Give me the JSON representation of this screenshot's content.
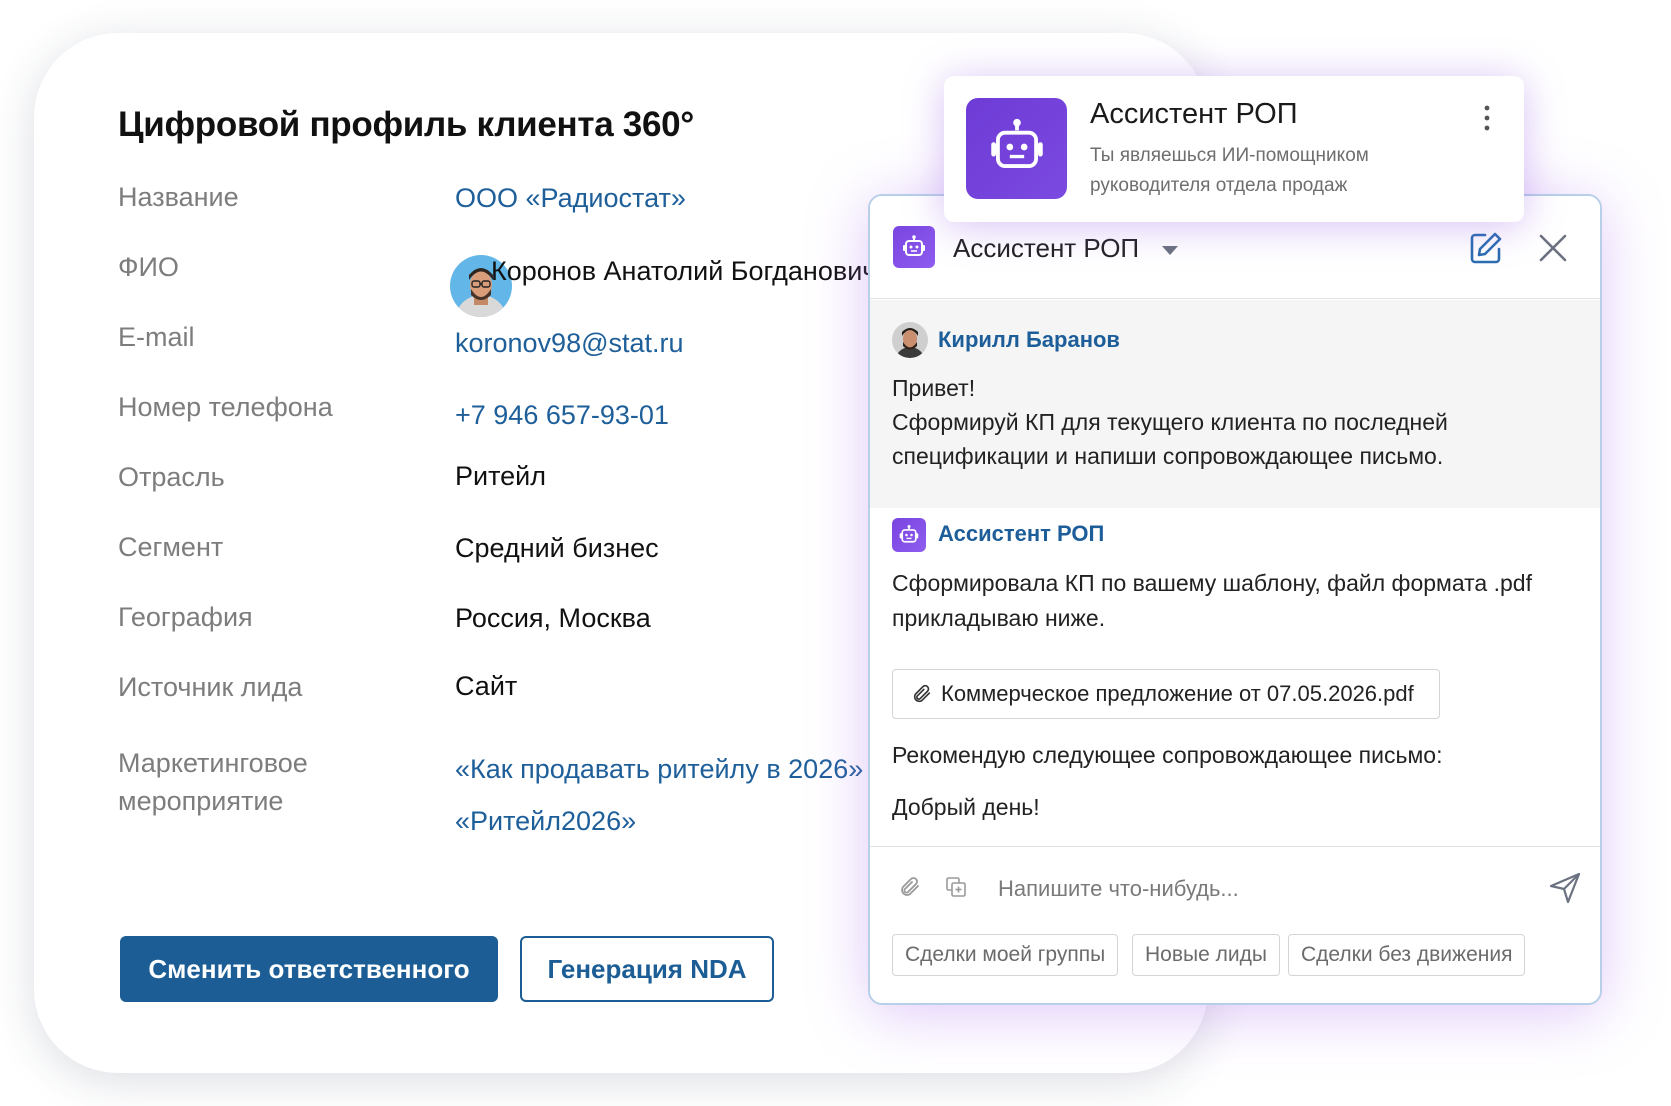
{
  "profile": {
    "title": "Цифровой профиль клиента 360°",
    "fields": {
      "name": {
        "label": "Название",
        "value": "ООО «Радиостат»"
      },
      "fio": {
        "label": "ФИО",
        "value": "Коронов Анатолий Богданович"
      },
      "email": {
        "label": "E-mail",
        "value": "koronov98@stat.ru"
      },
      "phone": {
        "label": "Номер телефона",
        "value": "+7 946 657-93-01"
      },
      "industry": {
        "label": "Отрасль",
        "value": "Ритейл"
      },
      "segment": {
        "label": "Сегмент",
        "value": "Средний бизнес"
      },
      "geo": {
        "label": "География",
        "value": "Россия, Москва"
      },
      "lead_source": {
        "label": "Источник лида",
        "value": "Сайт"
      },
      "marketing": {
        "label_line1": "Маркетинговое",
        "label_line2": "мероприятие",
        "event1": "«Как продавать ритейлу в 2026»",
        "event2": "«Ритейл2026»"
      }
    },
    "buttons": {
      "change_owner": "Сменить ответственного",
      "nda": "Генерация NDA"
    }
  },
  "assistant_card": {
    "name": "Ассистент РОП",
    "description": "Ты являешься ИИ-помощником руководителя отдела продаж"
  },
  "chat": {
    "title": "Ассистент РОП",
    "messages": {
      "user": {
        "author": "Кирилл Баранов",
        "line1": "Привет!",
        "line2": "Сформируй КП для текущего клиента по последней",
        "line3": "спецификации и напиши сопровождающее письмо."
      },
      "bot": {
        "author": "Ассистент РОП",
        "line1": "Сформировала КП по вашему шаблону, файл формата .pdf",
        "line2": "прикладываю ниже.",
        "attachment": "Коммерческое предложение от 07.05.2026.pdf",
        "line3": "Рекомендую следующее сопровождающее письмо:",
        "line4": "Добрый день!"
      }
    },
    "composer": {
      "placeholder": "Напишите что-нибудь...",
      "value": ""
    },
    "quick_replies": [
      "Сделки моей группы",
      "Новые лиды",
      "Сделки без движения"
    ]
  },
  "colors": {
    "link": "#1e5f9a",
    "primary": "#1b5d94",
    "assistant_purple": "#6e3bd6",
    "label_gray": "#7d7d7d"
  },
  "icons": [
    "robot-icon",
    "kebab-menu-icon",
    "chevron-down-icon",
    "edit-icon",
    "close-icon",
    "paperclip-icon",
    "add-file-icon",
    "send-icon"
  ]
}
